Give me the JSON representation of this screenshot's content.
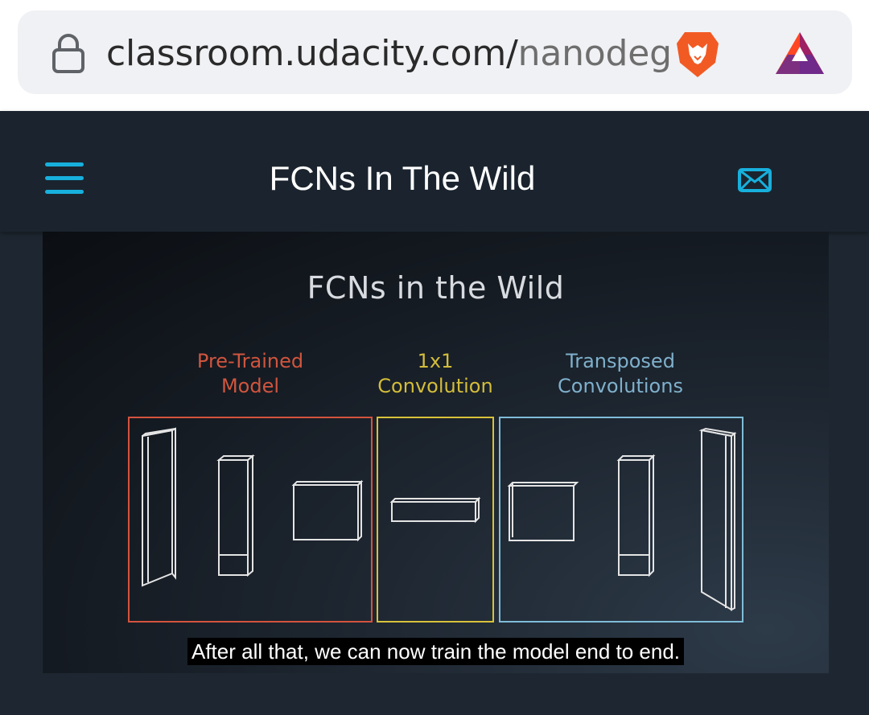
{
  "browser": {
    "url_main": "classroom.udacity.com/",
    "url_rest": "nanodeg",
    "icons": [
      "lock-icon",
      "brave-lion-icon",
      "bat-rewards-icon"
    ]
  },
  "header": {
    "title": "FCNs In The Wild",
    "icons": [
      "menu-icon",
      "mail-icon"
    ],
    "accent_color": "#17b0dd"
  },
  "video": {
    "slide_title": "FCNs in the Wild",
    "sections": [
      {
        "line1": "Pre-Trained",
        "line2": "Model",
        "color": "#d4533e"
      },
      {
        "line1": "1x1",
        "line2": "Convolution",
        "color": "#d8c23a"
      },
      {
        "line1": "Transposed",
        "line2": "Convolutions",
        "color": "#7fbcd8"
      }
    ],
    "caption": "After all that, we can now train the model end to end."
  }
}
